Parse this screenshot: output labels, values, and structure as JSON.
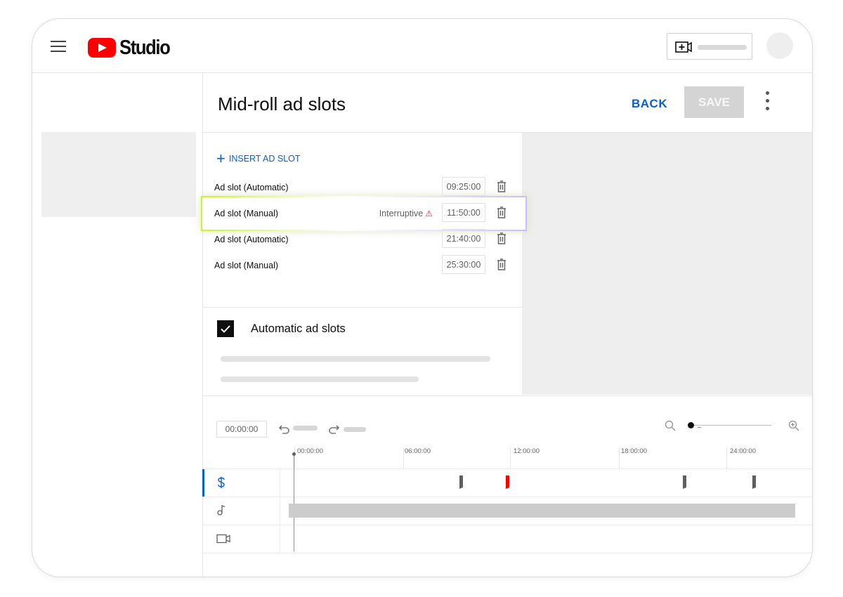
{
  "app": {
    "logo_text": "Studio"
  },
  "header": {
    "menu_icon": "hamburger-icon",
    "create_icon": "video-add-icon"
  },
  "page": {
    "title": "Mid-roll ad slots",
    "back_label": "BACK",
    "save_label": "SAVE",
    "more_icon": "kebab-icon"
  },
  "slots": {
    "insert_label": "INSERT AD SLOT",
    "items": [
      {
        "label": "Ad slot (Automatic)",
        "time": "09:25:00",
        "flag": ""
      },
      {
        "label": "Ad slot (Manual)",
        "time": "11:50:00",
        "flag": "Interruptive"
      },
      {
        "label": "Ad slot (Automatic)",
        "time": "21:40:00",
        "flag": ""
      },
      {
        "label": "Ad slot (Manual)",
        "time": "25:30:00",
        "flag": ""
      }
    ]
  },
  "automatic": {
    "label": "Automatic ad slots",
    "checked": true
  },
  "timeline": {
    "current_time": "00:00:00",
    "ticks": [
      "00:00:00",
      "06:00:00",
      "12:00:00",
      "18:00:00",
      "24:00:00"
    ],
    "tracks": [
      "dollar-icon",
      "music-note-icon",
      "video-camera-icon"
    ],
    "colors": {
      "marker": "#606060",
      "selected_marker": "#ff0000",
      "accent": "#065fd4"
    }
  }
}
